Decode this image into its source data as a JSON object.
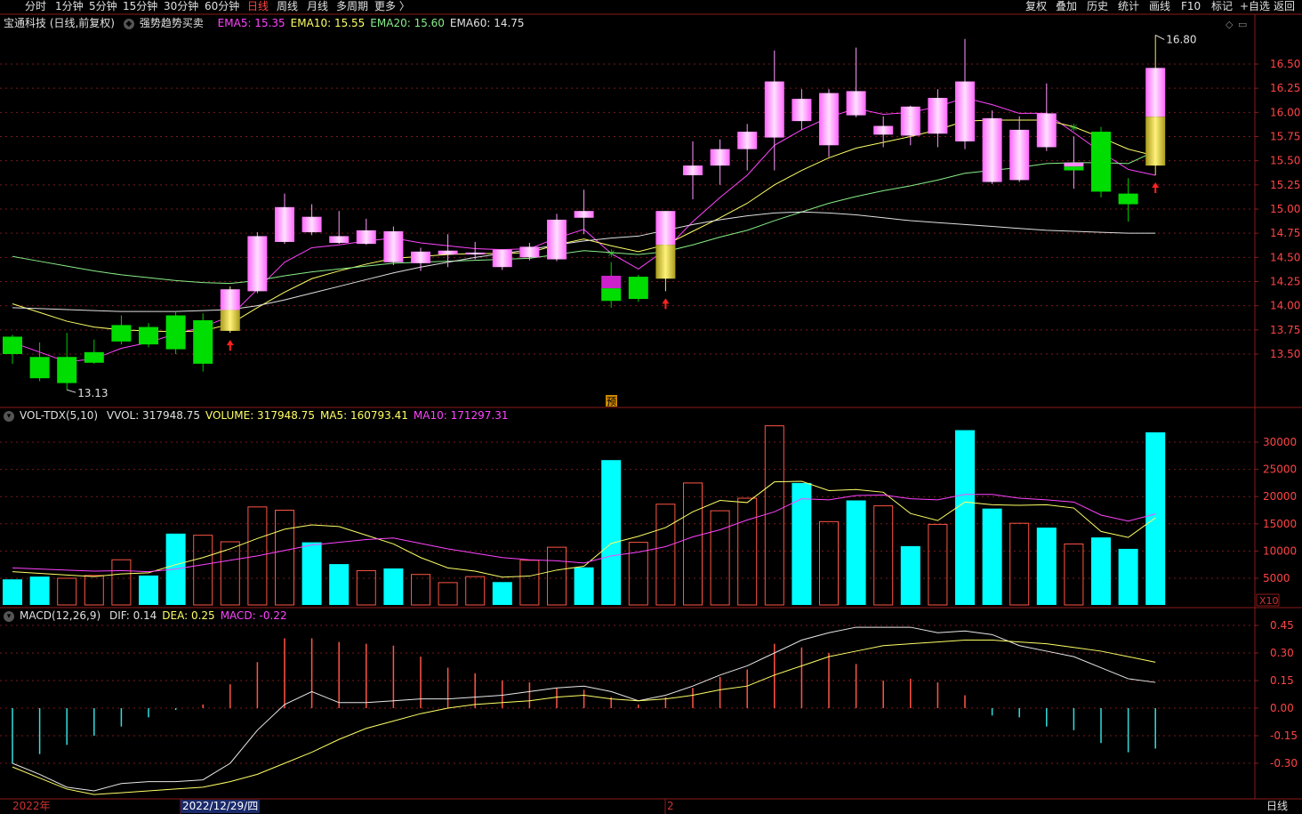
{
  "toolbar": {
    "periods": [
      "分时",
      "1分钟",
      "5分钟",
      "15分钟",
      "30分钟",
      "60分钟",
      "日线",
      "周线",
      "月线",
      "多周期",
      "更多 〉"
    ],
    "active_period": "日线",
    "right": [
      "复权",
      "叠加",
      "历史",
      "统计",
      "画线",
      "F10",
      "标记",
      "+自选",
      "返回"
    ]
  },
  "price_panel": {
    "title": "宝通科技 (日线,前复权)",
    "indicator": "强势趋势买卖",
    "ema": [
      {
        "label": "EMA5: 15.35",
        "color": "#ff44ff"
      },
      {
        "label": "EMA10: 15.55",
        "color": "#ffff66"
      },
      {
        "label": "EMA20: 15.60",
        "color": "#88ee88"
      },
      {
        "label": "EMA60: 14.75",
        "color": "#e0e0e0"
      }
    ],
    "high_label": "16.80",
    "low_label": "13.13",
    "pre_label": "预"
  },
  "vol_panel": {
    "title": "VOL-TDX(5,10)",
    "items": [
      {
        "label": "VVOL: 317948.75",
        "color": "#e0e0e0"
      },
      {
        "label": "VOLUME: 317948.75",
        "color": "#ffff66"
      },
      {
        "label": "MA5: 160793.41",
        "color": "#ffff66"
      },
      {
        "label": "MA10: 171297.31",
        "color": "#ff44ff"
      }
    ],
    "unit": "X10"
  },
  "macd_panel": {
    "title": "MACD(12,26,9)",
    "items": [
      {
        "label": "DIF: 0.14",
        "color": "#e0e0e0"
      },
      {
        "label": "DEA: 0.25",
        "color": "#ffff66"
      },
      {
        "label": "MACD: -0.22",
        "color": "#ff44ff"
      }
    ]
  },
  "bottom": {
    "year": "2022年",
    "date": "2022/12/29/四",
    "month": "2",
    "period": "日线"
  },
  "chart_data": [
    {
      "type": "candlestick",
      "title": "宝通科技 (日线,前复权)",
      "ylim": [
        13.13,
        16.8
      ],
      "y_ticks": [
        "16.50",
        "16.25",
        "16.00",
        "15.75",
        "15.50",
        "15.25",
        "15.00",
        "14.75",
        "14.50",
        "14.25",
        "14.00",
        "13.75",
        "13.50"
      ],
      "candles": [
        {
          "o": 13.5,
          "h": 13.7,
          "l": 13.4,
          "c": 13.68,
          "color": "green"
        },
        {
          "o": 13.47,
          "h": 13.62,
          "l": 13.22,
          "c": 13.25,
          "color": "green"
        },
        {
          "o": 13.47,
          "h": 13.72,
          "l": 13.13,
          "c": 13.2,
          "color": "green"
        },
        {
          "o": 13.41,
          "h": 13.65,
          "l": 13.4,
          "c": 13.52,
          "color": "green"
        },
        {
          "o": 13.63,
          "h": 13.9,
          "l": 13.6,
          "c": 13.8,
          "color": "green"
        },
        {
          "o": 13.6,
          "h": 13.82,
          "l": 13.57,
          "c": 13.78,
          "color": "green"
        },
        {
          "o": 13.55,
          "h": 13.94,
          "l": 13.5,
          "c": 13.9,
          "color": "green"
        },
        {
          "o": 13.4,
          "h": 13.92,
          "l": 13.32,
          "c": 13.85,
          "color": "green"
        },
        {
          "o": 13.74,
          "h": 14.2,
          "l": 13.72,
          "c": 14.17,
          "color": "pinkgold"
        },
        {
          "o": 14.15,
          "h": 14.76,
          "l": 14.13,
          "c": 14.72,
          "color": "pink"
        },
        {
          "o": 14.66,
          "h": 15.16,
          "l": 14.64,
          "c": 15.02,
          "color": "pink"
        },
        {
          "o": 14.76,
          "h": 15.05,
          "l": 14.73,
          "c": 14.92,
          "color": "pink"
        },
        {
          "o": 14.65,
          "h": 14.98,
          "l": 14.64,
          "c": 14.72,
          "color": "pink"
        },
        {
          "o": 14.64,
          "h": 14.9,
          "l": 14.63,
          "c": 14.78,
          "color": "pink"
        },
        {
          "o": 14.45,
          "h": 14.82,
          "l": 14.42,
          "c": 14.77,
          "color": "pink"
        },
        {
          "o": 14.44,
          "h": 14.6,
          "l": 14.36,
          "c": 14.56,
          "color": "pink"
        },
        {
          "o": 14.53,
          "h": 14.74,
          "l": 14.4,
          "c": 14.57,
          "color": "pink"
        },
        {
          "o": 14.53,
          "h": 14.66,
          "l": 14.48,
          "c": 14.55,
          "color": "pink"
        },
        {
          "o": 14.4,
          "h": 14.58,
          "l": 14.37,
          "c": 14.58,
          "color": "pink"
        },
        {
          "o": 14.5,
          "h": 14.65,
          "l": 14.47,
          "c": 14.61,
          "color": "pink"
        },
        {
          "o": 14.48,
          "h": 14.95,
          "l": 14.46,
          "c": 14.89,
          "color": "pink"
        },
        {
          "o": 14.91,
          "h": 15.2,
          "l": 14.74,
          "c": 14.98,
          "color": "pink"
        },
        {
          "o": 14.31,
          "h": 14.45,
          "l": 13.98,
          "c": 14.05,
          "color": "greenmagenta"
        },
        {
          "o": 14.3,
          "h": 14.32,
          "l": 14.04,
          "c": 14.07,
          "color": "green"
        },
        {
          "o": 14.28,
          "h": 14.96,
          "l": 14.15,
          "c": 14.98,
          "color": "pinkgold"
        },
        {
          "o": 15.35,
          "h": 15.7,
          "l": 15.1,
          "c": 15.45,
          "color": "pink"
        },
        {
          "o": 15.45,
          "h": 15.72,
          "l": 15.25,
          "c": 15.62,
          "color": "pink"
        },
        {
          "o": 15.62,
          "h": 15.88,
          "l": 15.4,
          "c": 15.8,
          "color": "pink"
        },
        {
          "o": 15.74,
          "h": 16.64,
          "l": 15.4,
          "c": 16.32,
          "color": "pink"
        },
        {
          "o": 15.91,
          "h": 16.24,
          "l": 15.82,
          "c": 16.14,
          "color": "pink"
        },
        {
          "o": 15.66,
          "h": 16.24,
          "l": 15.54,
          "c": 16.2,
          "color": "pink"
        },
        {
          "o": 15.97,
          "h": 16.67,
          "l": 15.95,
          "c": 16.22,
          "color": "pink"
        },
        {
          "o": 15.77,
          "h": 15.96,
          "l": 15.64,
          "c": 15.86,
          "color": "pink"
        },
        {
          "o": 15.76,
          "h": 16.07,
          "l": 15.66,
          "c": 16.06,
          "color": "pink"
        },
        {
          "o": 15.78,
          "h": 16.24,
          "l": 15.64,
          "c": 16.15,
          "color": "pink"
        },
        {
          "o": 15.7,
          "h": 16.76,
          "l": 15.62,
          "c": 16.32,
          "color": "pink"
        },
        {
          "o": 15.28,
          "h": 16.02,
          "l": 15.26,
          "c": 15.94,
          "color": "pink"
        },
        {
          "o": 15.3,
          "h": 15.96,
          "l": 15.28,
          "c": 15.82,
          "color": "pink"
        },
        {
          "o": 15.64,
          "h": 16.3,
          "l": 15.6,
          "c": 15.99,
          "color": "pink"
        },
        {
          "o": 15.48,
          "h": 15.75,
          "l": 15.21,
          "c": 15.4,
          "color": "pinkgreen"
        },
        {
          "o": 15.8,
          "h": 15.85,
          "l": 15.12,
          "c": 15.18,
          "color": "green"
        },
        {
          "o": 15.16,
          "h": 15.32,
          "l": 14.87,
          "c": 15.05,
          "color": "green"
        },
        {
          "o": 15.45,
          "h": 16.8,
          "l": 15.35,
          "c": 16.46,
          "color": "pinkgold"
        }
      ],
      "ema": {
        "EMA5": [
          13.62,
          13.52,
          13.42,
          13.45,
          13.56,
          13.62,
          13.71,
          13.78,
          13.89,
          14.17,
          14.45,
          14.6,
          14.63,
          14.67,
          14.7,
          14.65,
          14.62,
          14.59,
          14.58,
          14.59,
          14.7,
          14.79,
          14.54,
          14.38,
          14.58,
          14.87,
          15.12,
          15.35,
          15.66,
          15.82,
          15.95,
          16.04,
          15.98,
          16.0,
          16.06,
          16.15,
          16.08,
          15.99,
          15.99,
          15.79,
          15.59,
          15.41,
          15.35
        ],
        "EMA10": [
          14.02,
          13.93,
          13.84,
          13.78,
          13.75,
          13.74,
          13.73,
          13.74,
          13.81,
          13.98,
          14.14,
          14.28,
          14.36,
          14.43,
          14.49,
          14.51,
          14.53,
          14.54,
          14.54,
          14.55,
          14.63,
          14.69,
          14.62,
          14.56,
          14.63,
          14.77,
          14.91,
          15.06,
          15.25,
          15.4,
          15.53,
          15.63,
          15.69,
          15.75,
          15.82,
          15.91,
          15.92,
          15.92,
          15.92,
          15.85,
          15.74,
          15.62,
          15.55
        ],
        "EMA20": [
          14.51,
          14.46,
          14.41,
          14.36,
          14.32,
          14.29,
          14.26,
          14.24,
          14.23,
          14.26,
          14.31,
          14.35,
          14.38,
          14.41,
          14.44,
          14.45,
          14.46,
          14.47,
          14.48,
          14.49,
          14.53,
          14.57,
          14.55,
          14.53,
          14.56,
          14.63,
          14.71,
          14.78,
          14.88,
          14.97,
          15.06,
          15.13,
          15.19,
          15.24,
          15.3,
          15.37,
          15.4,
          15.43,
          15.47,
          15.48,
          15.48,
          15.47,
          15.6
        ],
        "EMA60": [
          13.98,
          13.97,
          13.96,
          13.95,
          13.94,
          13.94,
          13.94,
          13.95,
          13.96,
          14.0,
          14.06,
          14.13,
          14.2,
          14.27,
          14.34,
          14.4,
          14.45,
          14.5,
          14.54,
          14.58,
          14.63,
          14.67,
          14.7,
          14.72,
          14.78,
          14.84,
          14.89,
          14.93,
          14.96,
          14.97,
          14.96,
          14.94,
          14.91,
          14.88,
          14.86,
          14.84,
          14.82,
          14.8,
          14.78,
          14.77,
          14.76,
          14.75,
          14.75
        ]
      },
      "signals": [
        {
          "i": 8,
          "type": "buy"
        },
        {
          "i": 22,
          "type": "star"
        },
        {
          "i": 24,
          "type": "buy"
        },
        {
          "i": 39,
          "type": "star"
        },
        {
          "i": 42,
          "type": "buy"
        }
      ]
    },
    {
      "type": "bar",
      "title": "VOL-TDX(5,10)",
      "unit": "X10",
      "ylim": [
        0,
        33000
      ],
      "y_ticks": [
        "30000",
        "25000",
        "20000",
        "15000",
        "10000",
        "5000"
      ],
      "values": [
        4800,
        5300,
        5000,
        5500,
        8400,
        5500,
        13200,
        12900,
        11700,
        18100,
        17500,
        11600,
        7600,
        6400,
        6800,
        5700,
        4200,
        5300,
        4300,
        8300,
        10700,
        7000,
        26700,
        11600,
        18600,
        22500,
        17400,
        19700,
        33000,
        22500,
        15400,
        19300,
        18300,
        10900,
        14900,
        32200,
        17800,
        15100,
        14300,
        11300,
        12500,
        10400,
        31800
      ],
      "bar_styles": [
        "cyan",
        "cyan",
        "hollow",
        "hollow",
        "hollow",
        "cyan",
        "cyan",
        "hollow",
        "hollow",
        "hollow",
        "hollow",
        "cyan",
        "cyan",
        "hollow",
        "cyan",
        "hollow",
        "hollow",
        "hollow",
        "cyan",
        "hollow",
        "hollow",
        "cyan",
        "cyan",
        "hollow",
        "hollow",
        "hollow",
        "hollow",
        "hollow",
        "hollow",
        "cyan",
        "hollow",
        "cyan",
        "hollow",
        "cyan",
        "hollow",
        "cyan",
        "cyan",
        "hollow",
        "cyan",
        "hollow",
        "cyan",
        "cyan",
        "cyan"
      ],
      "MA5": [
        6200,
        5900,
        5600,
        5300,
        5800,
        6000,
        7500,
        8800,
        10400,
        12300,
        14000,
        14800,
        14500,
        12900,
        11300,
        8800,
        6900,
        6300,
        5200,
        5400,
        6500,
        7200,
        11400,
        12700,
        14300,
        17200,
        19300,
        18900,
        22700,
        22800,
        21100,
        21300,
        20800,
        16900,
        15600,
        19000,
        18500,
        18400,
        18500,
        17900,
        13600,
        12500,
        16100
      ],
      "MA10": [
        6900,
        6700,
        6500,
        6300,
        6400,
        6200,
        6700,
        7500,
        8300,
        9100,
        10100,
        11100,
        11600,
        12100,
        12400,
        11400,
        10400,
        9600,
        8800,
        8400,
        8200,
        7800,
        9100,
        9800,
        10800,
        12600,
        13900,
        15700,
        17200,
        19600,
        19400,
        20200,
        20300,
        19600,
        19400,
        20400,
        20400,
        19700,
        19400,
        19000,
        16600,
        15500,
        16800
      ]
    },
    {
      "type": "bar",
      "title": "MACD(12,26,9)",
      "ylim": [
        -0.45,
        0.51
      ],
      "y_ticks": [
        "0.45",
        "0.30",
        "0.15",
        "0.00",
        "-0.15",
        "-0.30"
      ],
      "macd": [
        -0.3,
        -0.25,
        -0.2,
        -0.15,
        -0.1,
        -0.05,
        -0.01,
        0.02,
        0.13,
        0.25,
        0.38,
        0.38,
        0.36,
        0.35,
        0.34,
        0.28,
        0.22,
        0.19,
        0.15,
        0.14,
        0.11,
        0.1,
        0.06,
        0.02,
        0.06,
        0.11,
        0.17,
        0.21,
        0.35,
        0.33,
        0.3,
        0.24,
        0.15,
        0.16,
        0.14,
        0.07,
        -0.04,
        -0.05,
        -0.1,
        -0.12,
        -0.19,
        -0.24,
        -0.22
      ],
      "DIF": [
        -0.3,
        -0.36,
        -0.43,
        -0.45,
        -0.41,
        -0.4,
        -0.4,
        -0.39,
        -0.3,
        -0.12,
        0.02,
        0.09,
        0.03,
        0.03,
        0.04,
        0.05,
        0.05,
        0.06,
        0.07,
        0.09,
        0.11,
        0.12,
        0.09,
        0.04,
        0.07,
        0.12,
        0.18,
        0.23,
        0.3,
        0.37,
        0.41,
        0.44,
        0.44,
        0.44,
        0.41,
        0.42,
        0.4,
        0.34,
        0.31,
        0.28,
        0.22,
        0.16,
        0.14
      ],
      "DEA": [
        -0.32,
        -0.38,
        -0.44,
        -0.47,
        -0.46,
        -0.45,
        -0.44,
        -0.43,
        -0.4,
        -0.36,
        -0.3,
        -0.24,
        -0.17,
        -0.11,
        -0.07,
        -0.03,
        0.0,
        0.02,
        0.03,
        0.04,
        0.06,
        0.07,
        0.05,
        0.04,
        0.05,
        0.07,
        0.1,
        0.12,
        0.18,
        0.23,
        0.28,
        0.31,
        0.34,
        0.35,
        0.36,
        0.37,
        0.37,
        0.36,
        0.35,
        0.33,
        0.31,
        0.28,
        0.25
      ]
    }
  ]
}
